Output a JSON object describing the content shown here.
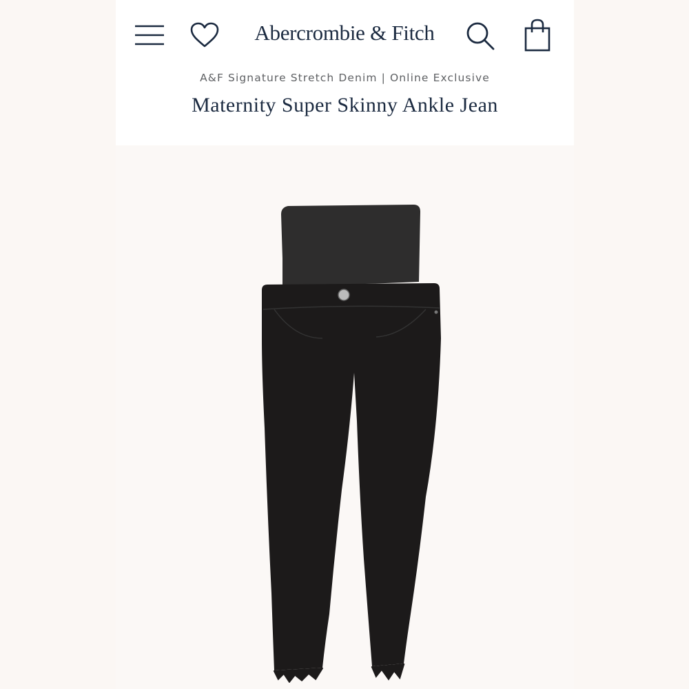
{
  "header": {
    "brand": "Abercrombie & Fitch",
    "icons": {
      "menu": "hamburger-menu-icon",
      "wishlist": "heart-icon",
      "search": "search-icon",
      "bag": "shopping-bag-icon"
    }
  },
  "product": {
    "collection": "A&F Signature Stretch Denim | Online Exclusive",
    "title": "Maternity Super Skinny Ankle Jean",
    "image_subject": "black maternity skinny jeans with full belly panel and frayed hem"
  },
  "colors": {
    "navy": "#1b2a40",
    "gray_text": "#5f6164",
    "denim_black": "#1c1a1a",
    "panel_black": "#2e2d2d",
    "background": "#fbf8f5"
  }
}
